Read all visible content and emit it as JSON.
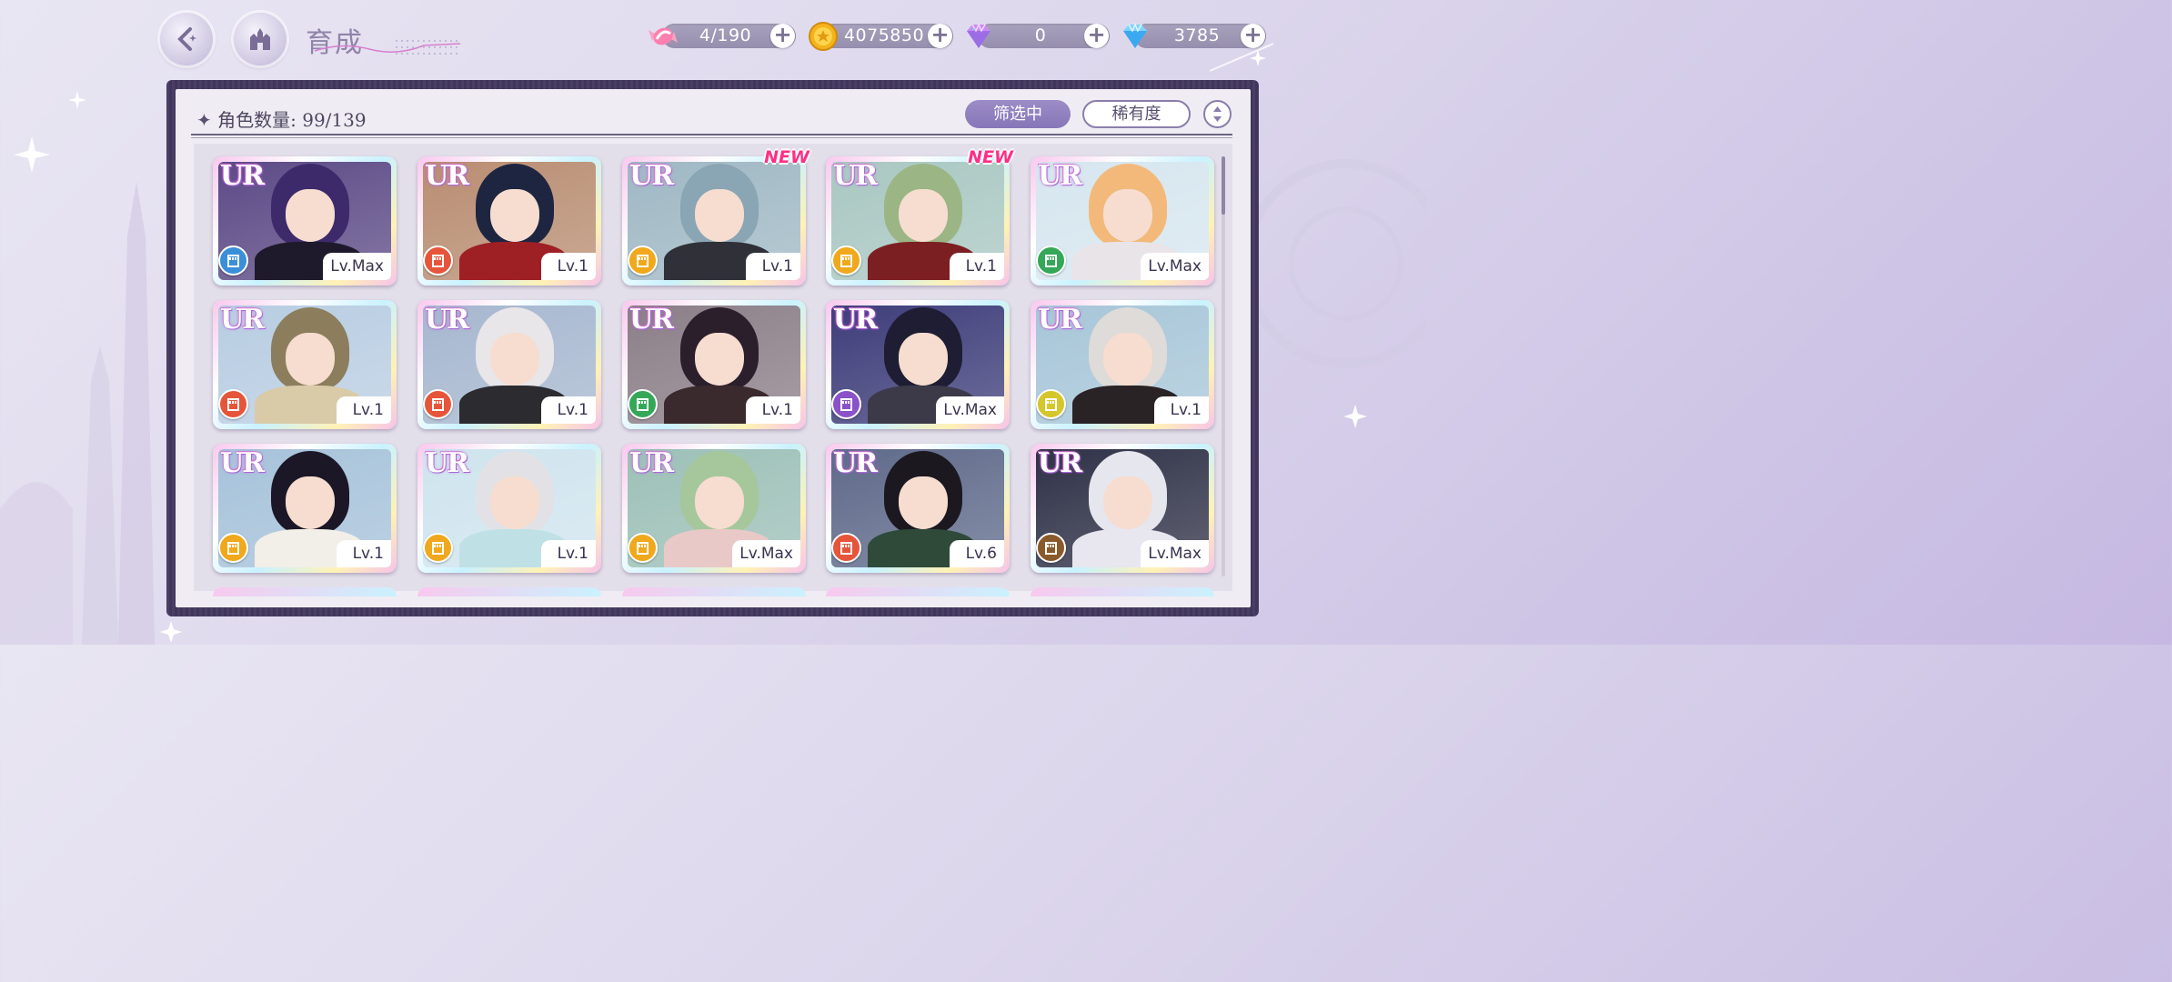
{
  "header": {
    "title": "育成",
    "resources": [
      {
        "icon": "candy-icon",
        "value": "4/190"
      },
      {
        "icon": "gold-coin-icon",
        "value": "4075850"
      },
      {
        "icon": "pink-diamond-icon",
        "value": "0"
      },
      {
        "icon": "blue-diamond-icon",
        "value": "3785"
      }
    ],
    "plus": "+"
  },
  "panel": {
    "count_label": "角色数量: 99/139",
    "filter_label": "筛选中",
    "rarity_label": "稀有度"
  },
  "cards": [
    {
      "rarity": "UR",
      "level": "Lv.Max",
      "attr_color": "#3b8ed8",
      "bg": "#5c4a86",
      "hair": "#3d2a6b",
      "outfit": "#1e1a2b",
      "new": ""
    },
    {
      "rarity": "UR",
      "level": "Lv.1",
      "attr_color": "#e6553a",
      "bg": "#b98d72",
      "hair": "#1e2540",
      "outfit": "#9e1f24",
      "new": ""
    },
    {
      "rarity": "UR",
      "level": "Lv.1",
      "attr_color": "#f0a81c",
      "bg": "#9fb8c4",
      "hair": "#8aa5b3",
      "outfit": "#2f3038",
      "new": "NEW"
    },
    {
      "rarity": "UR",
      "level": "Lv.1",
      "attr_color": "#f0a81c",
      "bg": "#a9c7c2",
      "hair": "#9bb585",
      "outfit": "#7c1f22",
      "new": "NEW"
    },
    {
      "rarity": "UR",
      "level": "Lv.Max",
      "attr_color": "#35a858",
      "bg": "#d6e6ef",
      "hair": "#f3b97a",
      "outfit": "#e9e4e8",
      "new": ""
    },
    {
      "rarity": "UR",
      "level": "Lv.1",
      "attr_color": "#e6553a",
      "bg": "#b8cde2",
      "hair": "#8c7d5d",
      "outfit": "#d9cba8",
      "new": ""
    },
    {
      "rarity": "UR",
      "level": "Lv.1",
      "attr_color": "#e6553a",
      "bg": "#a6b7cf",
      "hair": "#e8e6e8",
      "outfit": "#2b2b30",
      "new": ""
    },
    {
      "rarity": "UR",
      "level": "Lv.1",
      "attr_color": "#35a858",
      "bg": "#8b7e88",
      "hair": "#2c1f2c",
      "outfit": "#3a2a2e",
      "new": ""
    },
    {
      "rarity": "UR",
      "level": "Lv.Max",
      "attr_color": "#8a52c8",
      "bg": "#3e3d7a",
      "hair": "#1f1d33",
      "outfit": "#3c3a48",
      "new": ""
    },
    {
      "rarity": "UR",
      "level": "Lv.1",
      "attr_color": "#d5c62c",
      "bg": "#a7c6d8",
      "hair": "#dedbd8",
      "outfit": "#2a2326",
      "new": ""
    },
    {
      "rarity": "UR",
      "level": "Lv.1",
      "attr_color": "#f0a81c",
      "bg": "#a6c2da",
      "hair": "#1b1726",
      "outfit": "#f2eee8",
      "new": ""
    },
    {
      "rarity": "UR",
      "level": "Lv.1",
      "attr_color": "#f0a81c",
      "bg": "#cfe4ee",
      "hair": "#e2e2e6",
      "outfit": "#bfe1e6",
      "new": ""
    },
    {
      "rarity": "UR",
      "level": "Lv.Max",
      "attr_color": "#f0a81c",
      "bg": "#9cc0b7",
      "hair": "#a6c79c",
      "outfit": "#e9c9c8",
      "new": ""
    },
    {
      "rarity": "UR",
      "level": "Lv.6",
      "attr_color": "#e6553a",
      "bg": "#5f6a8a",
      "hair": "#1b1820",
      "outfit": "#2f4a39",
      "new": ""
    },
    {
      "rarity": "UR",
      "level": "Lv.Max",
      "attr_color": "#8a5a2a",
      "bg": "#2f3147",
      "hair": "#e6e6ee",
      "outfit": "#e8e6ef",
      "new": ""
    }
  ]
}
